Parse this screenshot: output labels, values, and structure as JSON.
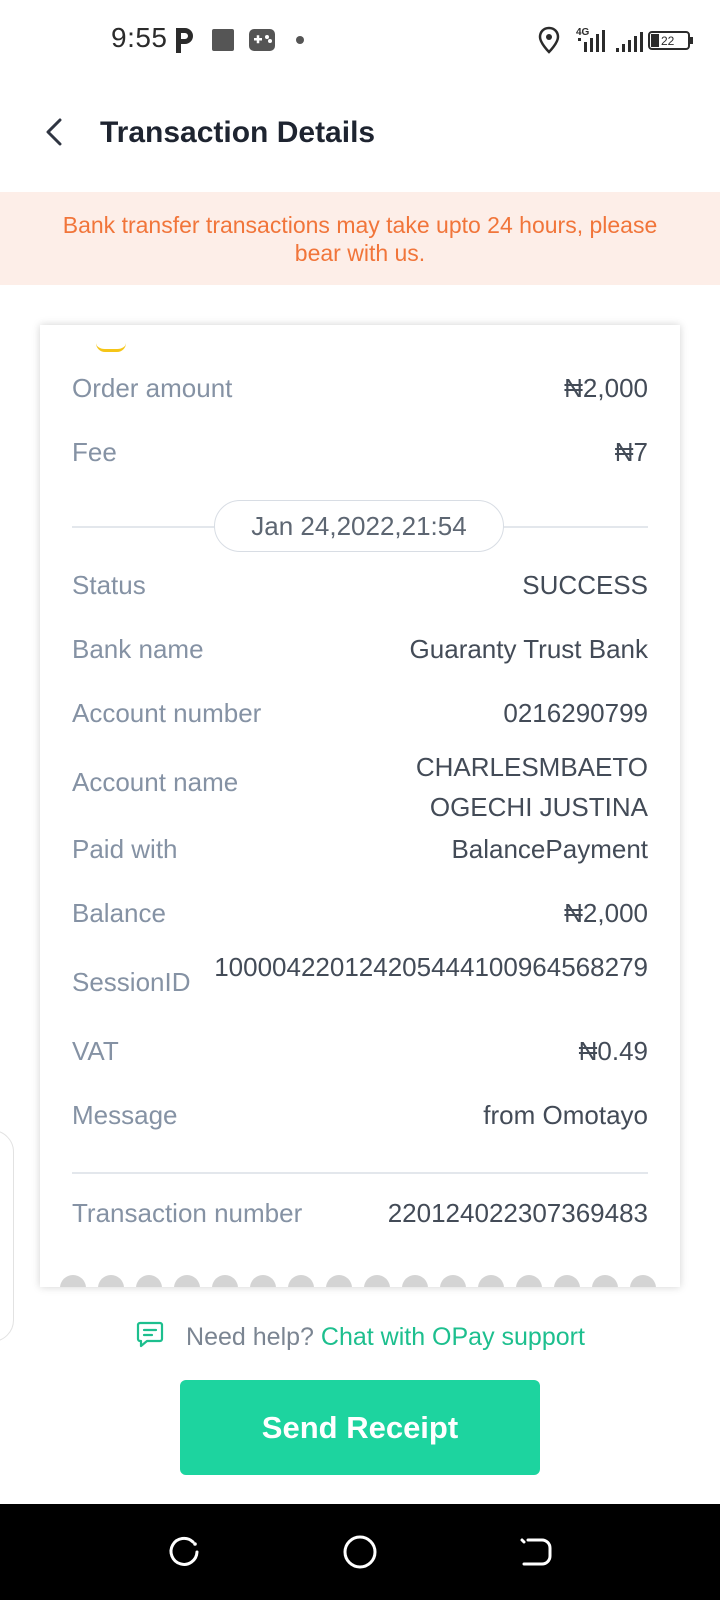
{
  "status_bar": {
    "time": "9:55",
    "battery_level": "22",
    "icons": [
      "parking-notification-icon",
      "stop-notification-icon",
      "gamepad-notification-icon",
      "dot-icon",
      "location-icon",
      "signal-4g-icon",
      "signal-icon",
      "battery-icon"
    ]
  },
  "header": {
    "title": "Transaction Details",
    "back_icon": "chevron-left-icon"
  },
  "banner": {
    "text": "Bank transfer transactions may take upto 24 hours, please bear with us."
  },
  "details": {
    "order_amount": {
      "label": "Order amount",
      "value": "₦2,000"
    },
    "fee": {
      "label": "Fee",
      "value": "₦7"
    },
    "date": "Jan 24,2022,21:54",
    "status": {
      "label": "Status",
      "value": "SUCCESS"
    },
    "bank_name": {
      "label": "Bank name",
      "value": "Guaranty Trust Bank"
    },
    "account_number": {
      "label": "Account number",
      "value": "0216290799"
    },
    "account_name": {
      "label": "Account name",
      "value": "CHARLESMBAETO OGECHI JUSTINA"
    },
    "paid_with": {
      "label": "Paid with",
      "value": "BalancePayment"
    },
    "balance": {
      "label": "Balance",
      "value": "₦2,000"
    },
    "session_id": {
      "label": "SessionID",
      "value": "100004220124205444100964568279"
    },
    "vat": {
      "label": "VAT",
      "value": "₦0.49"
    },
    "message": {
      "label": "Message",
      "value": "from Omotayo"
    },
    "transaction_number": {
      "label": "Transaction number",
      "value": "220124022307369483"
    }
  },
  "help": {
    "prefix": "Need help?",
    "link": "Chat with OPay support",
    "icon": "chat-icon"
  },
  "actions": {
    "send_receipt": "Send Receipt"
  },
  "colors": {
    "accent": "#1dd49f",
    "link": "#1dbf8e",
    "banner_bg": "#fdeee8",
    "banner_text": "#f1753a"
  },
  "nav": {
    "icons": [
      "recents-icon",
      "home-icon",
      "back-icon"
    ]
  }
}
